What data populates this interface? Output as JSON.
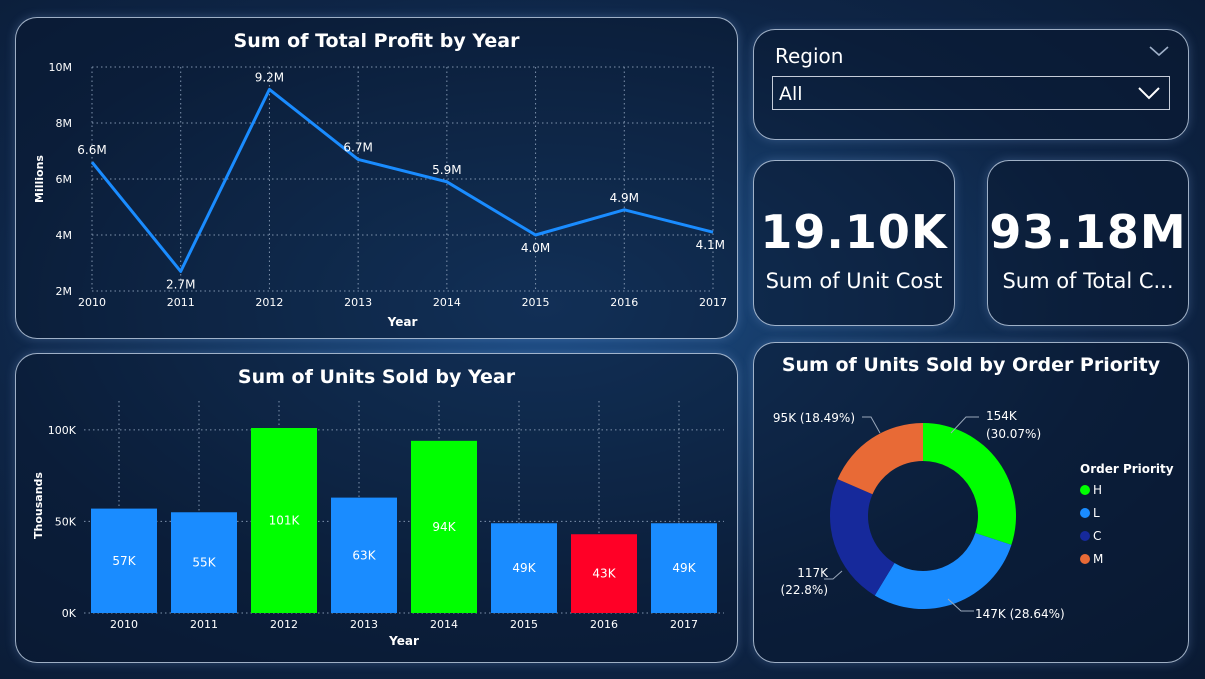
{
  "profit_chart": {
    "title": "Sum of Total Profit by Year",
    "xlabel": "Year",
    "ylabel": "Millions",
    "chart_data": {
      "type": "line",
      "x": [
        "2010",
        "2011",
        "2012",
        "2013",
        "2014",
        "2015",
        "2016",
        "2017"
      ],
      "values": [
        6.6,
        2.7,
        9.2,
        6.7,
        5.9,
        4.0,
        4.9,
        4.1
      ],
      "labels": [
        "6.6M",
        "2.7M",
        "9.2M",
        "6.7M",
        "5.9M",
        "4.0M",
        "4.9M",
        "4.1M"
      ],
      "yticks": [
        "2M",
        "4M",
        "6M",
        "8M",
        "10M"
      ],
      "ytick_values": [
        2,
        4,
        6,
        8,
        10
      ],
      "ylim": [
        2,
        10
      ],
      "color": "#1a8cff",
      "grid": true
    }
  },
  "units_chart": {
    "title": "Sum of Units Sold by Year",
    "xlabel": "Year",
    "ylabel": "Thousands",
    "chart_data": {
      "type": "bar",
      "categories": [
        "2010",
        "2011",
        "2012",
        "2013",
        "2014",
        "2015",
        "2016",
        "2017"
      ],
      "values": [
        57,
        55,
        101,
        63,
        94,
        49,
        43,
        49
      ],
      "labels": [
        "57K",
        "55K",
        "101K",
        "63K",
        "94K",
        "49K",
        "43K",
        "49K"
      ],
      "colors": [
        "#1a8cff",
        "#1a8cff",
        "#00ff00",
        "#1a8cff",
        "#00ff00",
        "#1a8cff",
        "#ff0026",
        "#1a8cff"
      ],
      "yticks": [
        "0K",
        "50K",
        "100K"
      ],
      "ytick_values": [
        0,
        50,
        100
      ],
      "ylim": [
        0,
        101
      ],
      "grid": true
    }
  },
  "region_filter": {
    "label": "Region",
    "selected": "All"
  },
  "kpis": [
    {
      "value": "19.10K",
      "label": "Sum of Unit Cost"
    },
    {
      "value": "93.18M",
      "label": "Sum of Total C..."
    }
  ],
  "donut_chart": {
    "title": "Sum of Units Sold by Order Priority",
    "legend_title": "Order Priority",
    "chart_data": {
      "type": "pie",
      "categories": [
        "H",
        "L",
        "C",
        "M"
      ],
      "values": [
        154,
        147,
        117,
        95
      ],
      "percents": [
        30.07,
        28.64,
        22.8,
        18.49
      ],
      "label_lines": [
        [
          "154K",
          "(30.07%)"
        ],
        [
          "147K (28.64%)"
        ],
        [
          "117K",
          "(22.8%)"
        ],
        [
          "95K (18.49%)"
        ]
      ],
      "colors": [
        "#00ff00",
        "#1a8cff",
        "#16299b",
        "#e86a36"
      ]
    }
  }
}
